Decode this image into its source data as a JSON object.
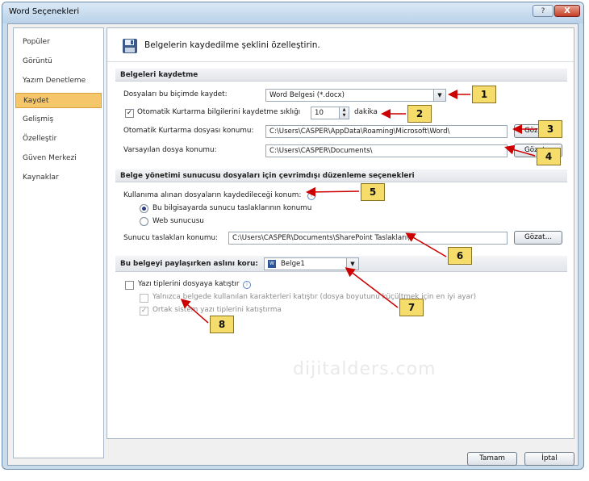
{
  "window": {
    "title": "Word Seçenekleri",
    "help_label": "?",
    "close_label": "X"
  },
  "sidebar": {
    "items": [
      {
        "label": "Popüler"
      },
      {
        "label": "Görüntü"
      },
      {
        "label": "Yazım Denetleme"
      },
      {
        "label": "Kaydet",
        "selected": true
      },
      {
        "label": "Gelişmiş"
      },
      {
        "label": "Özelleştir"
      },
      {
        "label": "Güven Merkezi"
      },
      {
        "label": "Kaynaklar"
      }
    ]
  },
  "main": {
    "page_title": "Belgelerin kaydedilme şeklini özelleştirin.",
    "save_section": {
      "header": "Belgeleri kaydetme",
      "format_label": "Dosyaları bu biçimde kaydet:",
      "format_value": "Word Belgesi (*.docx)",
      "autorecover_label": "Otomatik Kurtarma bilgilerini kaydetme sıklığı",
      "autorecover_checked": true,
      "autorecover_value": "10",
      "autorecover_unit": "dakika",
      "autorecover_location_label": "Otomatik Kurtarma dosyası konumu:",
      "autorecover_location_value": "C:\\Users\\CASPER\\AppData\\Roaming\\Microsoft\\Word\\",
      "default_location_label": "Varsayılan dosya konumu:",
      "default_location_value": "C:\\Users\\CASPER\\Documents\\",
      "browse_label": "Gözat..."
    },
    "offline_section": {
      "header": "Belge yönetimi sunucusu dosyaları için çevrimdışı düzenleme seçenekleri",
      "question_label": "Kullanıma alınan dosyaların kaydedileceği konum:",
      "option_local": "Bu bilgisayarda sunucu taslaklarının konumu",
      "option_web": "Web sunucusu",
      "drafts_label": "Sunucu taslakları konumu:",
      "drafts_value": "C:\\Users\\CASPER\\Documents\\SharePoint Taslakları\\",
      "browse_label": "Gözat..."
    },
    "fidelity_section": {
      "header": "Bu belgeyi paylaşırken aslını koru:",
      "document_value": "Belge1",
      "embed_fonts_label": "Yazı tiplerini dosyaya katıştır",
      "embed_fonts_checked": false,
      "only_used_chars_label": "Yalnızca belgede kullanılan karakterleri katıştır (dosya boyutunu küçültmek için en iyi ayar)",
      "only_used_chars_checked": false,
      "common_fonts_label": "Ortak sistem yazı tiplerini katıştırma",
      "common_fonts_checked": true
    }
  },
  "footer": {
    "ok_label": "Tamam",
    "cancel_label": "İptal"
  },
  "watermark": "dijitalders.com",
  "callouts": [
    "1",
    "2",
    "3",
    "4",
    "5",
    "6",
    "7",
    "8"
  ],
  "colors": {
    "callout_fill": "#f6dc6a",
    "arrow": "#cc0000",
    "selected_item": "#f5c76a",
    "title_bar": "#c9dcec"
  },
  "icons": {
    "save": "floppy-disk-icon",
    "info": "info-icon",
    "word_doc": "word-document-icon",
    "dropdown": "chevron-down-icon"
  }
}
